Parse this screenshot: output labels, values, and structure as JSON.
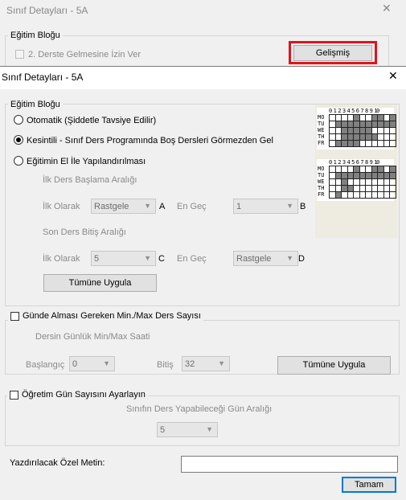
{
  "background_window": {
    "title": "Sınıf Detayları - 5A",
    "close": "✕",
    "group_label": "Eğitim Bloğu",
    "checkbox_label": "2. Derste Gelmesine İzin Ver",
    "advanced_button": "Gelişmiş",
    "highlight_color": "#e0141e"
  },
  "dialog": {
    "title": "Sınıf Detayları - 5A",
    "close": "✕",
    "egitim_blogu": {
      "label": "Eğitim Bloğu",
      "radios": [
        {
          "label": "Otomatik (Şiddetle Tavsiye Edilir)",
          "selected": false
        },
        {
          "label": "Kesintili - Sınıf Ders Programında Boş Dersleri Görmezden Gel",
          "selected": true
        },
        {
          "label": "Eğitimin El İle Yapılandırılması",
          "selected": false
        }
      ],
      "ilk_ders_title": "İlk Ders Başlama Aralığı",
      "ilk_olarak": "İlk Olarak",
      "en_gec": "En Geç",
      "first_start": "Rastgele",
      "first_end": "1",
      "letter_a": "A",
      "letter_b": "B",
      "son_ders_title": "Son Ders Bitiş Aralığı",
      "last_start": "5",
      "last_end": "Rastgele",
      "letter_c": "C",
      "letter_d": "D",
      "apply_all": "Tümüne Uygula"
    },
    "preview": {
      "header": "0 1 2 3 4 5 6 7 8 9 10",
      "days": [
        "MO",
        "TU",
        "WE",
        "TH",
        "FR"
      ],
      "top_grid": [
        [
          0,
          0,
          0,
          0,
          1,
          0,
          0,
          1,
          1,
          0,
          1
        ],
        [
          0,
          1,
          1,
          1,
          1,
          1,
          1,
          1,
          1,
          1,
          1
        ],
        [
          0,
          0,
          1,
          1,
          1,
          1,
          1,
          0,
          0,
          0,
          0
        ],
        [
          0,
          0,
          1,
          1,
          1,
          1,
          1,
          1,
          0,
          0,
          0
        ],
        [
          0,
          1,
          1,
          1,
          1,
          0,
          0,
          0,
          0,
          0,
          0
        ]
      ],
      "bottom_grid": [
        [
          0,
          0,
          0,
          0,
          1,
          0,
          0,
          1,
          1,
          0,
          1
        ],
        [
          0,
          1,
          1,
          1,
          1,
          1,
          1,
          1,
          1,
          1,
          1
        ],
        [
          0,
          0,
          1,
          0,
          0,
          0,
          0,
          0,
          0,
          0,
          0
        ],
        [
          0,
          0,
          1,
          1,
          0,
          0,
          0,
          0,
          0,
          0,
          0
        ],
        [
          0,
          1,
          0,
          0,
          0,
          0,
          0,
          0,
          0,
          0,
          0
        ]
      ]
    },
    "daily_lessons": {
      "checkbox_label": "Günde Alması Gereken Min./Max Ders Sayısı",
      "subtitle": "Dersin Günlük Min/Max Saati",
      "start_label": "Başlangıç",
      "start_value": "0",
      "end_label": "Bitiş",
      "end_value": "32",
      "apply_all": "Tümüne Uygula"
    },
    "teaching_days": {
      "checkbox_label": "Öğretim Gün Sayısını Ayarlayın",
      "subtitle": "Sınıfın Ders Yapabileceği Gün Aralığı",
      "value": "5"
    },
    "special_text_label": "Yazdırılacak Özel Metin:",
    "special_text_value": "",
    "ok_button": "Tamam"
  }
}
